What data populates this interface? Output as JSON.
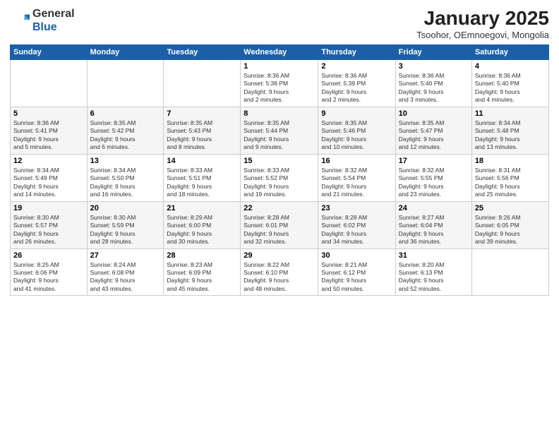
{
  "header": {
    "logo_general": "General",
    "logo_blue": "Blue",
    "month_title": "January 2025",
    "subtitle": "Tsoohor, OEmnoegovi, Mongolia"
  },
  "days_of_week": [
    "Sunday",
    "Monday",
    "Tuesday",
    "Wednesday",
    "Thursday",
    "Friday",
    "Saturday"
  ],
  "weeks": [
    [
      {
        "day": "",
        "info": ""
      },
      {
        "day": "",
        "info": ""
      },
      {
        "day": "",
        "info": ""
      },
      {
        "day": "1",
        "info": "Sunrise: 8:36 AM\nSunset: 5:38 PM\nDaylight: 9 hours\nand 2 minutes."
      },
      {
        "day": "2",
        "info": "Sunrise: 8:36 AM\nSunset: 5:39 PM\nDaylight: 9 hours\nand 2 minutes."
      },
      {
        "day": "3",
        "info": "Sunrise: 8:36 AM\nSunset: 5:40 PM\nDaylight: 9 hours\nand 3 minutes."
      },
      {
        "day": "4",
        "info": "Sunrise: 8:36 AM\nSunset: 5:40 PM\nDaylight: 9 hours\nand 4 minutes."
      }
    ],
    [
      {
        "day": "5",
        "info": "Sunrise: 8:36 AM\nSunset: 5:41 PM\nDaylight: 9 hours\nand 5 minutes."
      },
      {
        "day": "6",
        "info": "Sunrise: 8:35 AM\nSunset: 5:42 PM\nDaylight: 9 hours\nand 6 minutes."
      },
      {
        "day": "7",
        "info": "Sunrise: 8:35 AM\nSunset: 5:43 PM\nDaylight: 9 hours\nand 8 minutes."
      },
      {
        "day": "8",
        "info": "Sunrise: 8:35 AM\nSunset: 5:44 PM\nDaylight: 9 hours\nand 9 minutes."
      },
      {
        "day": "9",
        "info": "Sunrise: 8:35 AM\nSunset: 5:46 PM\nDaylight: 9 hours\nand 10 minutes."
      },
      {
        "day": "10",
        "info": "Sunrise: 8:35 AM\nSunset: 5:47 PM\nDaylight: 9 hours\nand 12 minutes."
      },
      {
        "day": "11",
        "info": "Sunrise: 8:34 AM\nSunset: 5:48 PM\nDaylight: 9 hours\nand 13 minutes."
      }
    ],
    [
      {
        "day": "12",
        "info": "Sunrise: 8:34 AM\nSunset: 5:49 PM\nDaylight: 9 hours\nand 14 minutes."
      },
      {
        "day": "13",
        "info": "Sunrise: 8:34 AM\nSunset: 5:50 PM\nDaylight: 9 hours\nand 16 minutes."
      },
      {
        "day": "14",
        "info": "Sunrise: 8:33 AM\nSunset: 5:51 PM\nDaylight: 9 hours\nand 18 minutes."
      },
      {
        "day": "15",
        "info": "Sunrise: 8:33 AM\nSunset: 5:52 PM\nDaylight: 9 hours\nand 19 minutes."
      },
      {
        "day": "16",
        "info": "Sunrise: 8:32 AM\nSunset: 5:54 PM\nDaylight: 9 hours\nand 21 minutes."
      },
      {
        "day": "17",
        "info": "Sunrise: 8:32 AM\nSunset: 5:55 PM\nDaylight: 9 hours\nand 23 minutes."
      },
      {
        "day": "18",
        "info": "Sunrise: 8:31 AM\nSunset: 5:56 PM\nDaylight: 9 hours\nand 25 minutes."
      }
    ],
    [
      {
        "day": "19",
        "info": "Sunrise: 8:30 AM\nSunset: 5:57 PM\nDaylight: 9 hours\nand 26 minutes."
      },
      {
        "day": "20",
        "info": "Sunrise: 8:30 AM\nSunset: 5:59 PM\nDaylight: 9 hours\nand 28 minutes."
      },
      {
        "day": "21",
        "info": "Sunrise: 8:29 AM\nSunset: 6:00 PM\nDaylight: 9 hours\nand 30 minutes."
      },
      {
        "day": "22",
        "info": "Sunrise: 8:28 AM\nSunset: 6:01 PM\nDaylight: 9 hours\nand 32 minutes."
      },
      {
        "day": "23",
        "info": "Sunrise: 8:28 AM\nSunset: 6:02 PM\nDaylight: 9 hours\nand 34 minutes."
      },
      {
        "day": "24",
        "info": "Sunrise: 8:27 AM\nSunset: 6:04 PM\nDaylight: 9 hours\nand 36 minutes."
      },
      {
        "day": "25",
        "info": "Sunrise: 8:26 AM\nSunset: 6:05 PM\nDaylight: 9 hours\nand 39 minutes."
      }
    ],
    [
      {
        "day": "26",
        "info": "Sunrise: 8:25 AM\nSunset: 6:06 PM\nDaylight: 9 hours\nand 41 minutes."
      },
      {
        "day": "27",
        "info": "Sunrise: 8:24 AM\nSunset: 6:08 PM\nDaylight: 9 hours\nand 43 minutes."
      },
      {
        "day": "28",
        "info": "Sunrise: 8:23 AM\nSunset: 6:09 PM\nDaylight: 9 hours\nand 45 minutes."
      },
      {
        "day": "29",
        "info": "Sunrise: 8:22 AM\nSunset: 6:10 PM\nDaylight: 9 hours\nand 48 minutes."
      },
      {
        "day": "30",
        "info": "Sunrise: 8:21 AM\nSunset: 6:12 PM\nDaylight: 9 hours\nand 50 minutes."
      },
      {
        "day": "31",
        "info": "Sunrise: 8:20 AM\nSunset: 6:13 PM\nDaylight: 9 hours\nand 52 minutes."
      },
      {
        "day": "",
        "info": ""
      }
    ]
  ]
}
